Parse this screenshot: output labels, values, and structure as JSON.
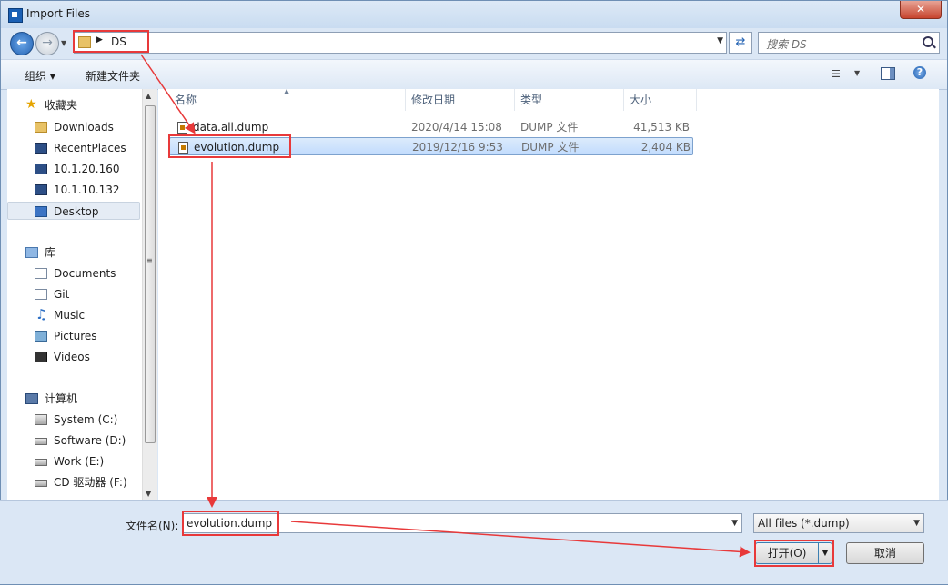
{
  "window": {
    "title": "Import Files",
    "close_label": "✕"
  },
  "address": {
    "path": "DS",
    "search_placeholder": "搜索 DS"
  },
  "toolbar": {
    "organize": "组织 ▾",
    "new_folder": "新建文件夹",
    "help": "?"
  },
  "sidebar": {
    "favorites": {
      "label": "收藏夹",
      "items": [
        {
          "label": "Downloads",
          "icon": "folder-icon"
        },
        {
          "label": "RecentPlaces",
          "icon": "recent-places-icon"
        },
        {
          "label": "10.1.20.160",
          "icon": "network-computer-icon"
        },
        {
          "label": "10.1.10.132",
          "icon": "network-computer-icon"
        },
        {
          "label": "Desktop",
          "icon": "desktop-icon",
          "selected": true
        }
      ]
    },
    "libraries": {
      "label": "库",
      "items": [
        {
          "label": "Documents",
          "icon": "documents-icon"
        },
        {
          "label": "Git",
          "icon": "git-icon"
        },
        {
          "label": "Music",
          "icon": "music-icon"
        },
        {
          "label": "Pictures",
          "icon": "pictures-icon"
        },
        {
          "label": "Videos",
          "icon": "videos-icon"
        }
      ]
    },
    "computer": {
      "label": "计算机",
      "items": [
        {
          "label": "System (C:)",
          "icon": "system-drive-icon"
        },
        {
          "label": "Software (D:)",
          "icon": "drive-icon"
        },
        {
          "label": "Work (E:)",
          "icon": "drive-icon"
        },
        {
          "label": "CD 驱动器 (F:)",
          "icon": "cd-drive-icon"
        }
      ]
    }
  },
  "columns": {
    "name": "名称",
    "modified": "修改日期",
    "type": "类型",
    "size": "大小"
  },
  "files": [
    {
      "name": "data.all.dump",
      "modified": "2020/4/14 15:08",
      "type": "DUMP 文件",
      "size": "41,513 KB",
      "selected": false
    },
    {
      "name": "evolution.dump",
      "modified": "2019/12/16 9:53",
      "type": "DUMP 文件",
      "size": "2,404 KB",
      "selected": true
    }
  ],
  "footer": {
    "filename_label": "文件名(N):",
    "filename_value": "evolution.dump",
    "filetype_value": "All files (*.dump)",
    "open_label": "打开(O)",
    "cancel_label": "取消"
  },
  "colors": {
    "annotation": "#e8393a",
    "selection": "#c2dcfd"
  }
}
